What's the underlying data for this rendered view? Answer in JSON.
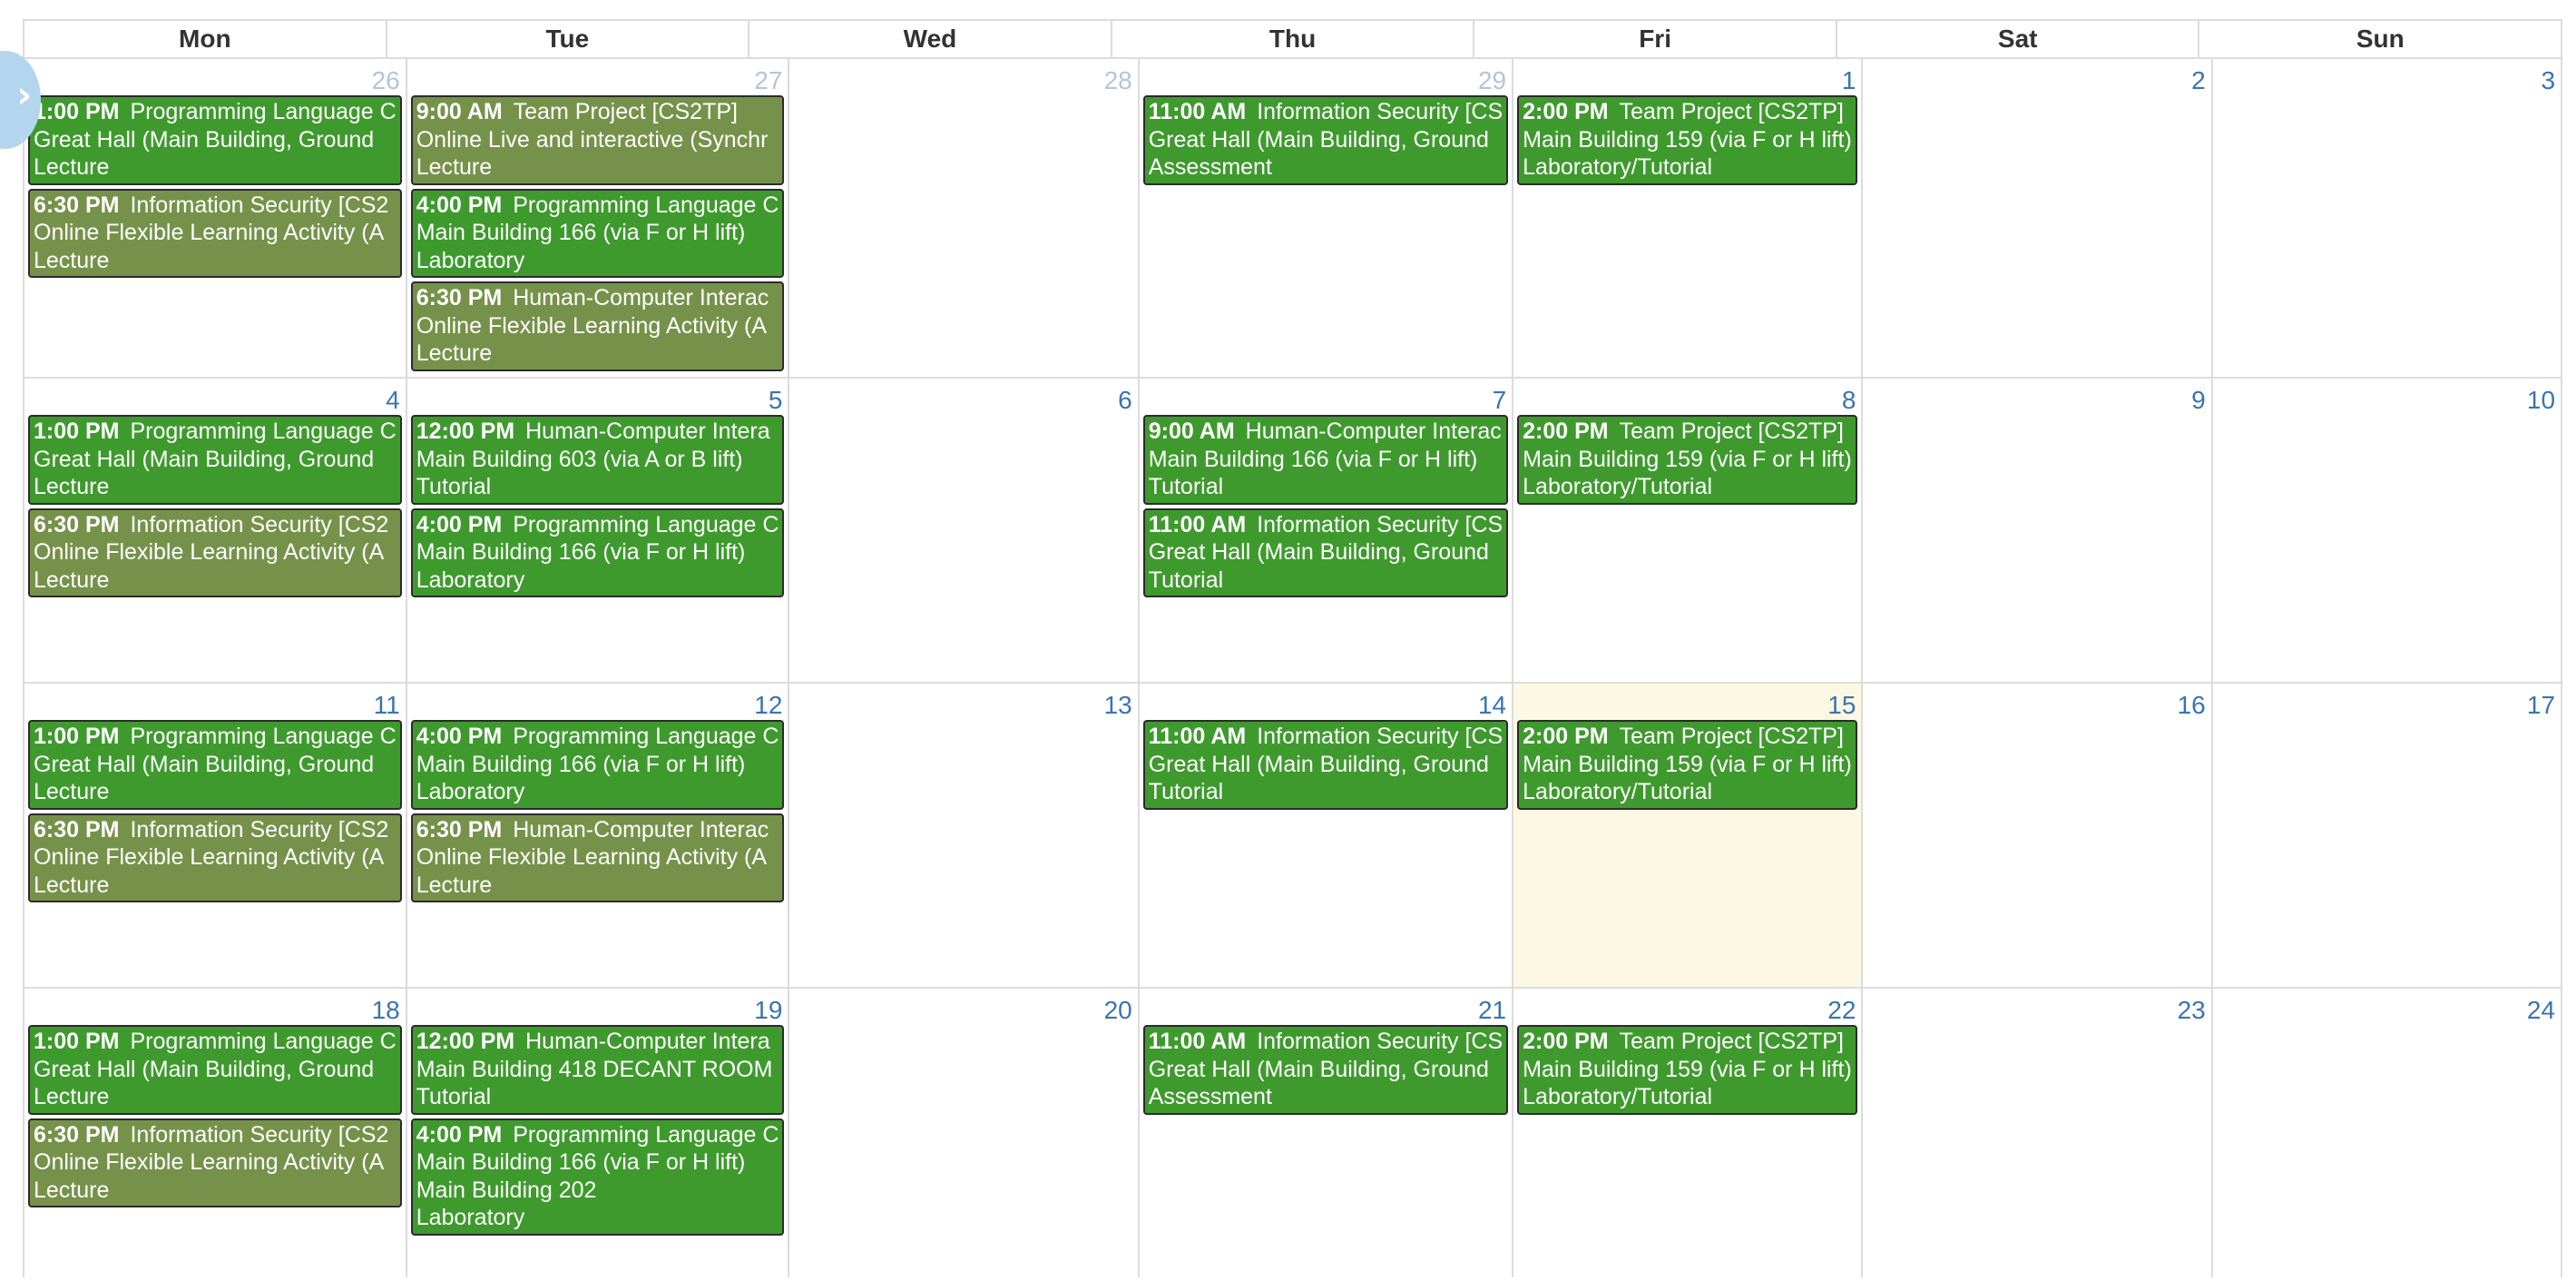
{
  "weekdays": [
    "Mon",
    "Tue",
    "Wed",
    "Thu",
    "Fri",
    "Sat",
    "Sun"
  ],
  "colors": {
    "event_green": "#3f9a2e",
    "event_olive": "#76924a",
    "today_bg": "#fcf8e3",
    "day_number": "#3a74b0",
    "other_month_number": "#b2c5dc"
  },
  "side_toggle_icon": "chevron-right-icon",
  "weeks": [
    {
      "days": [
        {
          "num": "26",
          "other": true,
          "events": [
            {
              "time": "1:00 PM",
              "title": "Programming Language C",
              "location": "Great Hall (Main Building, Ground",
              "type": "Lecture",
              "color": "green"
            },
            {
              "time": "6:30 PM",
              "title": "Information Security [CS2",
              "location": "Online Flexible Learning Activity (A",
              "type": "Lecture",
              "color": "olive"
            }
          ]
        },
        {
          "num": "27",
          "other": true,
          "events": [
            {
              "time": "9:00 AM",
              "title": "Team Project [CS2TP]",
              "location": "Online Live and interactive (Synchr",
              "type": "Lecture",
              "color": "olive"
            },
            {
              "time": "4:00 PM",
              "title": "Programming Language C",
              "location": "Main Building 166 (via F or H lift)",
              "type": "Laboratory",
              "color": "green"
            },
            {
              "time": "6:30 PM",
              "title": "Human-Computer Interac",
              "location": "Online Flexible Learning Activity (A",
              "type": "Lecture",
              "color": "olive"
            }
          ]
        },
        {
          "num": "28",
          "other": true,
          "events": []
        },
        {
          "num": "29",
          "other": true,
          "events": [
            {
              "time": "11:00 AM",
              "title": "Information Security [CS",
              "location": "Great Hall (Main Building, Ground",
              "type": "Assessment",
              "color": "green"
            }
          ]
        },
        {
          "num": "1",
          "events": [
            {
              "time": "2:00 PM",
              "title": "Team Project [CS2TP]",
              "location": "Main Building 159 (via F or H lift)",
              "type": "Laboratory/Tutorial",
              "color": "green"
            }
          ]
        },
        {
          "num": "2",
          "events": []
        },
        {
          "num": "3",
          "events": []
        }
      ]
    },
    {
      "days": [
        {
          "num": "4",
          "events": [
            {
              "time": "1:00 PM",
              "title": "Programming Language C",
              "location": "Great Hall (Main Building, Ground",
              "type": "Lecture",
              "color": "green"
            },
            {
              "time": "6:30 PM",
              "title": "Information Security [CS2",
              "location": "Online Flexible Learning Activity (A",
              "type": "Lecture",
              "color": "olive"
            }
          ]
        },
        {
          "num": "5",
          "events": [
            {
              "time": "12:00 PM",
              "title": "Human-Computer Intera",
              "location": "Main Building 603 (via A or B lift)",
              "type": "Tutorial",
              "color": "green"
            },
            {
              "time": "4:00 PM",
              "title": "Programming Language C",
              "location": "Main Building 166 (via F or H lift)",
              "type": "Laboratory",
              "color": "green"
            }
          ]
        },
        {
          "num": "6",
          "events": []
        },
        {
          "num": "7",
          "events": [
            {
              "time": "9:00 AM",
              "title": "Human-Computer Interac",
              "location": "Main Building 166 (via F or H lift)",
              "type": "Tutorial",
              "color": "green"
            },
            {
              "time": "11:00 AM",
              "title": "Information Security [CS",
              "location": "Great Hall (Main Building, Ground",
              "type": "Tutorial",
              "color": "green"
            }
          ]
        },
        {
          "num": "8",
          "events": [
            {
              "time": "2:00 PM",
              "title": "Team Project [CS2TP]",
              "location": "Main Building 159 (via F or H lift)",
              "type": "Laboratory/Tutorial",
              "color": "green"
            }
          ]
        },
        {
          "num": "9",
          "events": []
        },
        {
          "num": "10",
          "events": []
        }
      ]
    },
    {
      "days": [
        {
          "num": "11",
          "events": [
            {
              "time": "1:00 PM",
              "title": "Programming Language C",
              "location": "Great Hall (Main Building, Ground",
              "type": "Lecture",
              "color": "green"
            },
            {
              "time": "6:30 PM",
              "title": "Information Security [CS2",
              "location": "Online Flexible Learning Activity (A",
              "type": "Lecture",
              "color": "olive"
            }
          ]
        },
        {
          "num": "12",
          "events": [
            {
              "time": "4:00 PM",
              "title": "Programming Language C",
              "location": "Main Building 166 (via F or H lift)",
              "type": "Laboratory",
              "color": "green"
            },
            {
              "time": "6:30 PM",
              "title": "Human-Computer Interac",
              "location": "Online Flexible Learning Activity (A",
              "type": "Lecture",
              "color": "olive"
            }
          ]
        },
        {
          "num": "13",
          "events": []
        },
        {
          "num": "14",
          "events": [
            {
              "time": "11:00 AM",
              "title": "Information Security [CS",
              "location": "Great Hall (Main Building, Ground",
              "type": "Tutorial",
              "color": "green"
            }
          ]
        },
        {
          "num": "15",
          "today": true,
          "events": [
            {
              "time": "2:00 PM",
              "title": "Team Project [CS2TP]",
              "location": "Main Building 159 (via F or H lift)",
              "type": "Laboratory/Tutorial",
              "color": "green"
            }
          ]
        },
        {
          "num": "16",
          "events": []
        },
        {
          "num": "17",
          "events": []
        }
      ]
    },
    {
      "days": [
        {
          "num": "18",
          "events": [
            {
              "time": "1:00 PM",
              "title": "Programming Language C",
              "location": "Great Hall (Main Building, Ground",
              "type": "Lecture",
              "color": "green"
            },
            {
              "time": "6:30 PM",
              "title": "Information Security [CS2",
              "location": "Online Flexible Learning Activity (A",
              "type": "Lecture",
              "color": "olive"
            }
          ]
        },
        {
          "num": "19",
          "events": [
            {
              "time": "12:00 PM",
              "title": "Human-Computer Intera",
              "location": "Main Building 418 DECANT ROOM",
              "type": "Tutorial",
              "color": "green"
            },
            {
              "time": "4:00 PM",
              "title": "Programming Language C",
              "location": "Main Building 166 (via F or H lift)",
              "location2": "Main Building 202",
              "type": "Laboratory",
              "color": "green"
            }
          ]
        },
        {
          "num": "20",
          "events": []
        },
        {
          "num": "21",
          "events": [
            {
              "time": "11:00 AM",
              "title": "Information Security [CS",
              "location": "Great Hall (Main Building, Ground",
              "type": "Assessment",
              "color": "green"
            }
          ]
        },
        {
          "num": "22",
          "events": [
            {
              "time": "2:00 PM",
              "title": "Team Project [CS2TP]",
              "location": "Main Building 159 (via F or H lift)",
              "type": "Laboratory/Tutorial",
              "color": "green"
            }
          ]
        },
        {
          "num": "23",
          "events": []
        },
        {
          "num": "24",
          "events": []
        }
      ]
    }
  ]
}
